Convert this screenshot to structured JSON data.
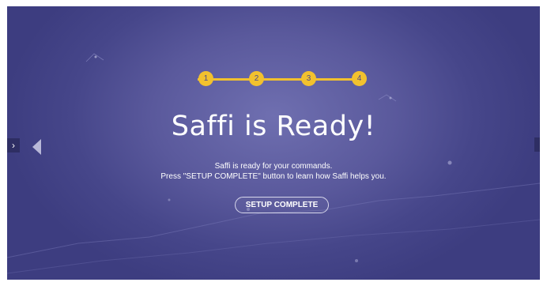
{
  "nav": {
    "left_tab_glyph": "›",
    "prev_icon": "triangle-left-icon"
  },
  "stepper": {
    "steps": [
      "1",
      "2",
      "3",
      "4"
    ],
    "active_color": "#f2c12e"
  },
  "main": {
    "title": "Saffi is Ready!",
    "line1": "Saffi is ready for your commands.",
    "line2": "Press \"SETUP COMPLETE\" button to learn how Saffi helps you."
  },
  "actions": {
    "setup_complete": "SETUP COMPLETE"
  },
  "theme": {
    "background": "#46468a",
    "accent": "#f2c12e",
    "text": "#ffffff"
  }
}
